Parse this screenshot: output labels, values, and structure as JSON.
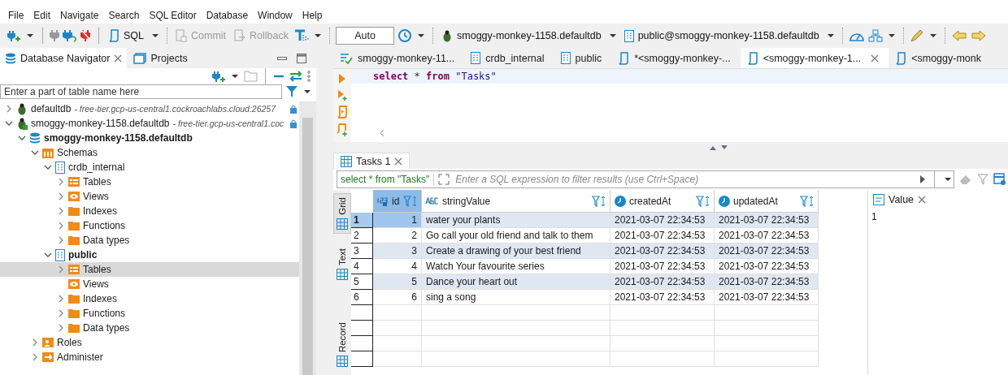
{
  "menu": [
    "File",
    "Edit",
    "Navigate",
    "Search",
    "SQL Editor",
    "Database",
    "Window",
    "Help"
  ],
  "toolbar": {
    "sql": "SQL",
    "commit": {
      "label": "Commit",
      "disabled": true
    },
    "rollback": {
      "label": "Rollback",
      "disabled": true
    },
    "transaction_mode": "Auto",
    "connection": "smoggy-monkey-1158.defaultdb",
    "schema": "public@smoggy-monkey-1158.defaultdb"
  },
  "navigator": {
    "tabs": [
      {
        "label": "Database Navigator",
        "selected": true
      },
      {
        "label": "Projects",
        "selected": false
      }
    ],
    "filter": {
      "placeholder": "Enter a part of table name here"
    },
    "tree": [
      {
        "label": "defaultdb",
        "detail": "- free-tier.gcp-us-central1.cockroachlabs.cloud:26257",
        "kind": "connection",
        "connected": false,
        "expanded": false,
        "active": false,
        "selected": false
      },
      {
        "label": "smoggy-monkey-1158.defaultdb",
        "detail": "- free-tier.gcp-us-central1.coc",
        "kind": "connection",
        "connected": true,
        "expanded": true,
        "active": false,
        "selected": false,
        "children": [
          {
            "label": "smoggy-monkey-1158.defaultdb",
            "kind": "database",
            "expanded": true,
            "active": true,
            "selected": false,
            "children": [
              {
                "label": "Schemas",
                "kind": "schemas",
                "expanded": true,
                "active": false,
                "selected": false,
                "children": [
                  {
                    "label": "crdb_internal",
                    "kind": "schema",
                    "expanded": true,
                    "active": false,
                    "selected": false,
                    "children": [
                      {
                        "label": "Tables",
                        "kind": "tables",
                        "expanded": false,
                        "active": false,
                        "selected": false
                      },
                      {
                        "label": "Views",
                        "kind": "views",
                        "expanded": false,
                        "active": false,
                        "selected": false
                      },
                      {
                        "label": "Indexes",
                        "kind": "folder",
                        "expanded": false,
                        "active": false,
                        "selected": false
                      },
                      {
                        "label": "Functions",
                        "kind": "folder",
                        "expanded": false,
                        "active": false,
                        "selected": false
                      },
                      {
                        "label": "Data types",
                        "kind": "folder",
                        "expanded": false,
                        "active": false,
                        "selected": false
                      }
                    ]
                  },
                  {
                    "label": "public",
                    "kind": "schema",
                    "expanded": true,
                    "active": true,
                    "selected": false,
                    "children": [
                      {
                        "label": "Tables",
                        "kind": "tables",
                        "expanded": false,
                        "active": false,
                        "selected": true
                      },
                      {
                        "label": "Views",
                        "kind": "views",
                        "expandable": false,
                        "active": false,
                        "selected": false
                      },
                      {
                        "label": "Indexes",
                        "kind": "folder",
                        "expanded": false,
                        "active": false,
                        "selected": false
                      },
                      {
                        "label": "Functions",
                        "kind": "folder",
                        "expanded": false,
                        "active": false,
                        "selected": false
                      },
                      {
                        "label": "Data types",
                        "kind": "folder",
                        "expanded": false,
                        "active": false,
                        "selected": false
                      }
                    ]
                  }
                ]
              },
              {
                "label": "Roles",
                "kind": "roles",
                "expanded": false,
                "active": false,
                "selected": false
              },
              {
                "label": "Administer",
                "kind": "administer",
                "expanded": false,
                "active": false,
                "selected": false
              }
            ]
          }
        ]
      }
    ]
  },
  "editor_tabs": [
    {
      "label": "smoggy-monkey-11...",
      "kind": "console",
      "selected": false
    },
    {
      "label": "crdb_internal",
      "kind": "schema",
      "selected": false
    },
    {
      "label": "public",
      "kind": "schema",
      "selected": false
    },
    {
      "label": "*<smoggy-monkey-...",
      "kind": "script",
      "selected": false
    },
    {
      "label": "<smoggy-monkey-1...",
      "kind": "script",
      "selected": true
    },
    {
      "label": "<smoggy-monk",
      "kind": "script",
      "selected": false
    }
  ],
  "sql": [
    {
      "text": "select",
      "kind": "keyword"
    },
    {
      "text": "*",
      "kind": "operator"
    },
    {
      "text": "from",
      "kind": "keyword"
    },
    {
      "text": "\"Tasks\"",
      "kind": "string"
    }
  ],
  "results": {
    "tab": "Tasks 1",
    "query": "select * from \"Tasks\"",
    "filter": {
      "placeholder": "Enter a SQL expression to filter results (use Ctrl+Space)"
    },
    "views": [
      {
        "label": "Grid",
        "selected": true
      },
      {
        "label": "Text",
        "selected": false
      },
      {
        "label": "Record",
        "selected": false
      }
    ],
    "columns": [
      {
        "name": "id",
        "kind": "number"
      },
      {
        "name": "stringValue",
        "kind": "text"
      },
      {
        "name": "createdAt",
        "kind": "datetime"
      },
      {
        "name": "updatedAt",
        "kind": "datetime"
      }
    ],
    "rows": [
      {
        "number": "1",
        "selected": true,
        "cells": [
          "1",
          "water your plants",
          "2021-03-07 22:34:53",
          "2021-03-07 22:34:53"
        ]
      },
      {
        "number": "2",
        "selected": false,
        "cells": [
          "2",
          "Go call your old friend and talk to them",
          "2021-03-07 22:34:53",
          "2021-03-07 22:34:53"
        ]
      },
      {
        "number": "3",
        "selected": false,
        "cells": [
          "3",
          "Create a drawing of your best friend",
          "2021-03-07 22:34:53",
          "2021-03-07 22:34:53"
        ]
      },
      {
        "number": "4",
        "selected": false,
        "cells": [
          "4",
          "Watch Your favourite series",
          "2021-03-07 22:34:53",
          "2021-03-07 22:34:53"
        ]
      },
      {
        "number": "5",
        "selected": false,
        "cells": [
          "5",
          "Dance your heart out",
          "2021-03-07 22:34:53",
          "2021-03-07 22:34:53"
        ]
      },
      {
        "number": "6",
        "selected": false,
        "cells": [
          "6",
          "sing a song",
          "2021-03-07 22:34:53",
          "2021-03-07 22:34:53"
        ]
      }
    ]
  },
  "value_panel": {
    "title": "Value",
    "content": "1"
  }
}
